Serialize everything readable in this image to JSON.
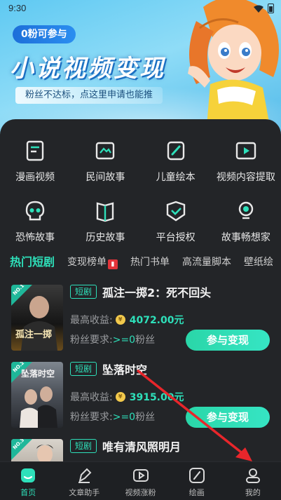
{
  "status_bar": {
    "time": "9:30"
  },
  "banner": {
    "tag": "0粉可参与",
    "title": "小说视频变现",
    "subtitle": "粉丝不达标，点这里申请也能推"
  },
  "features": [
    {
      "label": "漫画视频",
      "icon": "comic-video-icon"
    },
    {
      "label": "民间故事",
      "icon": "folk-story-icon"
    },
    {
      "label": "儿童绘本",
      "icon": "picture-book-icon"
    },
    {
      "label": "视频内容提取",
      "icon": "video-extract-icon"
    },
    {
      "label": "恐怖故事",
      "icon": "skull-icon"
    },
    {
      "label": "历史故事",
      "icon": "history-book-icon"
    },
    {
      "label": "平台授权",
      "icon": "shield-check-icon"
    },
    {
      "label": "故事畅想家",
      "icon": "lightbulb-icon"
    }
  ],
  "category_tabs": [
    {
      "label": "热门短剧",
      "active": true
    },
    {
      "label": "变现榜单",
      "badge": true
    },
    {
      "label": "热门书单"
    },
    {
      "label": "高流量脚本"
    },
    {
      "label": "壁纸绘"
    }
  ],
  "dramas": [
    {
      "rank": "NO.1",
      "tag": "短剧",
      "title": "孤注一掷2：死不回头",
      "earn_label": "最高收益:",
      "coin": "¥",
      "earn_value": "4072.00元",
      "req_label": "粉丝要求:",
      "req_value": ">=0",
      "req_unit": "粉丝",
      "button": "参与变现",
      "poster_text": "孤注一掷"
    },
    {
      "rank": "NO.2",
      "tag": "短剧",
      "title": "坠落时空",
      "earn_label": "最高收益:",
      "coin": "¥",
      "earn_value": "3915.00元",
      "req_label": "粉丝要求:",
      "req_value": ">=0",
      "req_unit": "粉丝",
      "button": "参与变现",
      "poster_text": "坠落时空"
    },
    {
      "rank": "NO.3",
      "tag": "短剧",
      "title": "唯有清风照明月"
    }
  ],
  "bottom_nav": [
    {
      "label": "首页",
      "active": true
    },
    {
      "label": "文章助手"
    },
    {
      "label": "视频涨粉"
    },
    {
      "label": "绘画"
    },
    {
      "label": "我的"
    }
  ],
  "colors": {
    "accent": "#2ee0ba",
    "panel": "#232528",
    "annotation_arrow": "#e8262b"
  }
}
